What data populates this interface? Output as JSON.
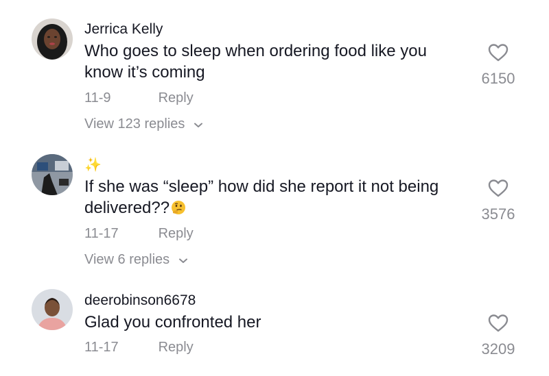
{
  "comments": [
    {
      "username": "Jerrica Kelly",
      "text_line1": "Who goes to sleep when ordering food like you",
      "text_line2": "know it’s coming",
      "date": "11-9",
      "reply_label": "Reply",
      "view_replies": "View 123 replies",
      "like_count": "6150"
    },
    {
      "username_icon": "sparkles-icon",
      "sparkle": "✨",
      "text_line1": "If she was “sleep” how did she report it not being",
      "text_line2": "delivered??",
      "emoji": "thinking-face-icon",
      "date": "11-17",
      "reply_label": "Reply",
      "view_replies": "View 6 replies",
      "like_count": "3576"
    },
    {
      "username": "deerobinson6678",
      "text_line1": "Glad you confronted her",
      "date": "11-17",
      "reply_label": "Reply",
      "like_count": "3209"
    }
  ],
  "colors": {
    "text": "#161823",
    "muted": "#8a8b91",
    "background": "#ffffff"
  }
}
